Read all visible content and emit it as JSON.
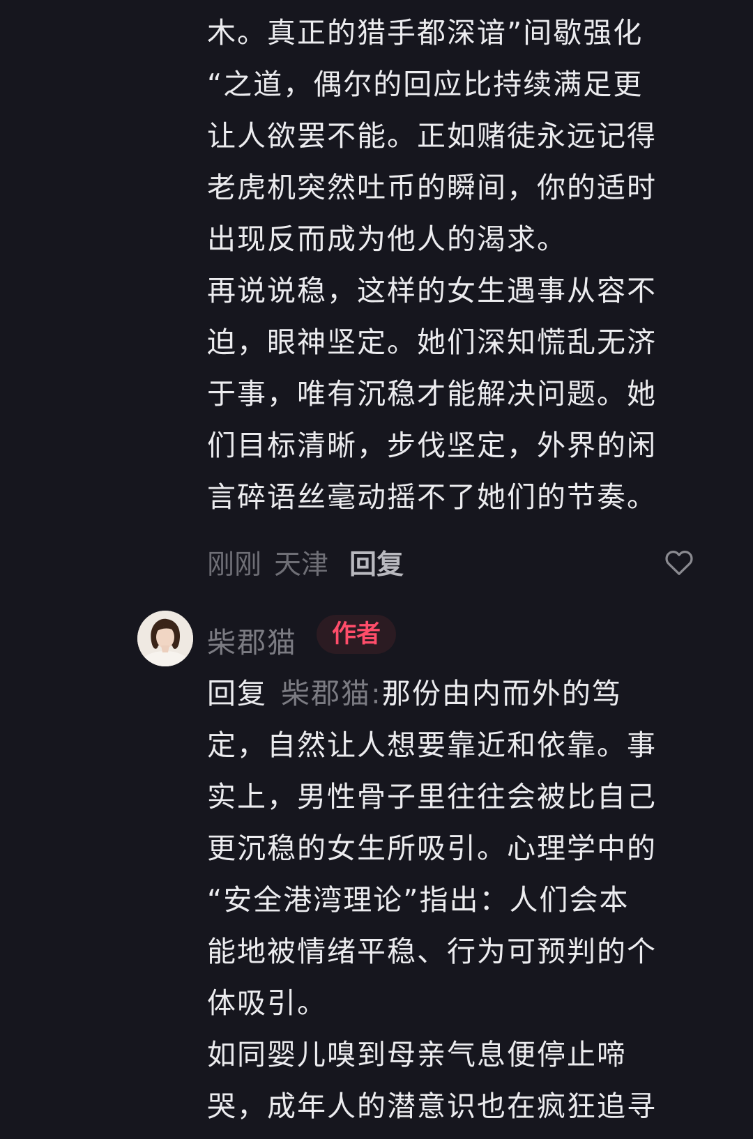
{
  "first_comment": {
    "lines": [
      "木。真正的猎手都深谙”间歇强化",
      "“之道，偶尔的回应比持续满足更",
      "让人欲罢不能。正如赌徒永远记得",
      "老虎机突然吐币的瞬间，你的适时",
      "出现反而成为他人的渴求。",
      "再说说稳，这样的女生遇事从容不",
      "迫，眼神坚定。她们深知慌乱无济",
      "于事，唯有沉稳才能解决问题。她",
      "们目标清晰，步伐坚定，外界的闲",
      "言碎语丝毫动摇不了她们的节奏。"
    ],
    "meta": {
      "time": "刚刚",
      "location": "天津",
      "reply_label": "回复"
    },
    "like_icon": "heart-outline-icon"
  },
  "reply": {
    "author_name": "柴郡猫",
    "author_badge": "作者",
    "avatar_icon": "user-avatar",
    "reply_prefix": "回复",
    "reply_target": "柴郡猫:",
    "first_line_text": "那份由内而外的笃",
    "lines": [
      "定，自然让人想要靠近和依靠。事",
      "实上，男性骨子里往往会被比自己",
      "更沉稳的女生所吸引。心理学中的",
      "“安全港湾理论”指出：人们会本",
      "能地被情绪平稳、行为可预判的个",
      "体吸引。",
      "如同婴儿嗅到母亲气息便停止啼",
      "哭，成年人的潜意识也在疯狂追寻"
    ]
  },
  "colors": {
    "background": "#16161e",
    "text": "#ececef",
    "muted": "#6f6f76",
    "badge_text": "#ff4d6a",
    "badge_bg": "#2b1b22"
  }
}
